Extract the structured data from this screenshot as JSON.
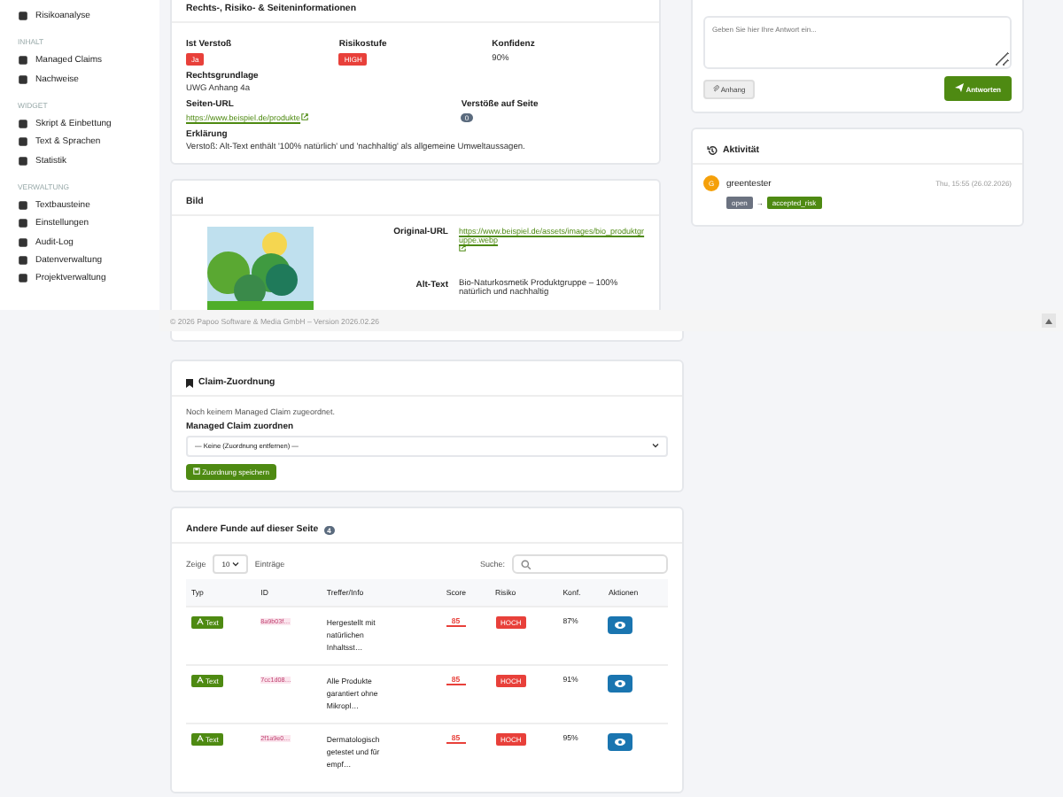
{
  "sidebar": {
    "sections": [
      {
        "items": [
          {
            "label": "Risikoanalyse"
          }
        ]
      },
      {
        "title": "INHALT",
        "items": [
          {
            "label": "Managed Claims"
          },
          {
            "label": "Nachweise"
          }
        ]
      },
      {
        "title": "WIDGET",
        "items": [
          {
            "label": "Skript & Einbettung"
          },
          {
            "label": "Text & Sprachen"
          },
          {
            "label": "Statistik"
          }
        ]
      },
      {
        "title": "VERWALTUNG",
        "items": [
          {
            "label": "Textbausteine"
          },
          {
            "label": "Einstellungen"
          },
          {
            "label": "Audit-Log"
          },
          {
            "label": "Datenverwaltung"
          },
          {
            "label": "Projektverwaltung"
          }
        ]
      }
    ]
  },
  "info_card": {
    "title": "Rechts-, Risiko- & Seiteninformationen",
    "violation_label": "Ist Verstoß",
    "violation": "Ja",
    "risk_label": "Risikostufe",
    "risk": "HIGH",
    "confidence_label": "Konfidenz",
    "confidence": "90%",
    "legal_label": "Rechtsgrundlage",
    "legal": "UWG Anhang 4a",
    "url_label": "Seiten-URL",
    "url": "https://www.beispiel.de/produkte",
    "count_label": "Verstöße auf Seite",
    "count": "0",
    "explanation_label": "Erklärung",
    "explanation": "Verstoß: Alt-Text enthält '100% natürlich' und 'nachhaltig' als allgemeine Umweltaussagen."
  },
  "image_card": {
    "title": "Bild",
    "original_url_label": "Original-URL",
    "original_url": "https://www.beispiel.de/assets/images/bio_produktgruppe.webp",
    "alt_label": "Alt-Text",
    "alt": "Bio-Naturkosmetik Produktgruppe – 100% natürlich und nachhaltig"
  },
  "reply": {
    "placeholder": "Geben Sie hier Ihre Antwort ein...",
    "attach": "Anhang",
    "submit": "Antworten"
  },
  "activity": {
    "title": "Aktivität",
    "avatar": "G",
    "user": "greentester",
    "time": "Thu, 15:55 (26.02.2026)",
    "from": "open",
    "arrow": "→",
    "to": "accepted_risk"
  },
  "footer": {
    "text": "© 2026 Papoo Software & Media GmbH – Version 2026.02.26"
  },
  "claim_card": {
    "title": "Claim-Zuordnung",
    "note": "Noch keinem Managed Claim zugeordnet.",
    "select_label": "Managed Claim zuordnen",
    "select_value": "— Keine (Zuordnung entfernen) —",
    "save": "Zuordnung speichern"
  },
  "findings": {
    "title": "Andere Funde auf dieser Seite",
    "count": "4",
    "show_label": "Zeige",
    "page_size": "10",
    "entries_label": "Einträge",
    "search_label": "Suche:",
    "columns": [
      "Typ",
      "ID",
      "Treffer/Info",
      "Score",
      "Risiko",
      "Konf.",
      "Aktionen"
    ],
    "rows": [
      {
        "kind": "text",
        "type": "Text",
        "id": "8a9b03f…",
        "info": "Hergestellt mit natürlichen Inhaltsst…",
        "score": "85",
        "risk": "HOCH",
        "conf": "87%"
      },
      {
        "kind": "text",
        "type": "Text",
        "id": "7cc1d08…",
        "info": "Alle Produkte garantiert ohne Mikropl…",
        "score": "85",
        "risk": "HOCH",
        "conf": "91%"
      },
      {
        "kind": "text",
        "type": "Text",
        "id": "2f1a9e0…",
        "info": "Dermatologisch getestet und für empf…",
        "score": "85",
        "risk": "HOCH",
        "conf": "95%"
      }
    ]
  }
}
